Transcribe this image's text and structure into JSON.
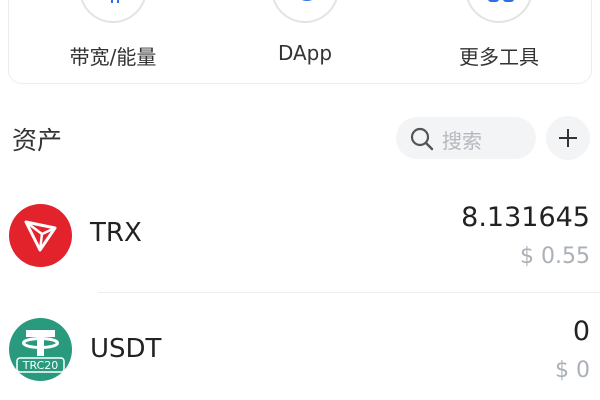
{
  "tools": {
    "items": [
      {
        "label": "带宽/能量",
        "icon": "chip-icon"
      },
      {
        "label": "DApp",
        "icon": "compass-icon"
      },
      {
        "label": "更多工具",
        "icon": "grid-icon"
      }
    ]
  },
  "assets": {
    "title": "资产",
    "search": {
      "placeholder": "搜索"
    },
    "add_icon": "plus-icon",
    "items": [
      {
        "symbol": "TRX",
        "amount": "8.131645",
        "value": "$ 0.55",
        "icon_color": "#e2232b"
      },
      {
        "symbol": "USDT",
        "amount": "0",
        "value": "$ 0",
        "icon_color": "#2a9a7f",
        "badge": "TRC20"
      }
    ]
  },
  "colors": {
    "accent_blue": "#2f6fe4",
    "muted_text": "#aab0b6",
    "search_bg": "#f2f4f6"
  }
}
